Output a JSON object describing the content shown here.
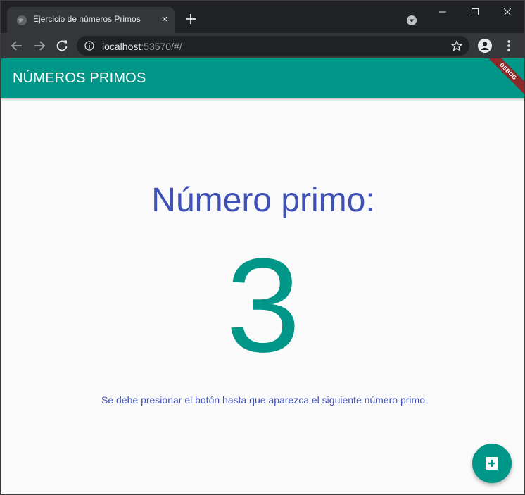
{
  "browser": {
    "tab": {
      "title": "Ejercicio de números Primos",
      "close_glyph": "×"
    },
    "address": {
      "host": "localhost",
      "rest": ":53570/#/"
    }
  },
  "app": {
    "appbar_title": "NÚMEROS PRIMOS",
    "debug_banner": "DEBUG",
    "heading": "Número primo:",
    "prime_value": "3",
    "hint": "Se debe presionar el botón hasta que aparezca el siguiente número primo",
    "fab_icon": "add-box-icon"
  },
  "colors": {
    "primary": "#009688",
    "accent_text": "#3f51b5",
    "background": "#fafafa",
    "debug_banner": "#8b2a2a"
  }
}
